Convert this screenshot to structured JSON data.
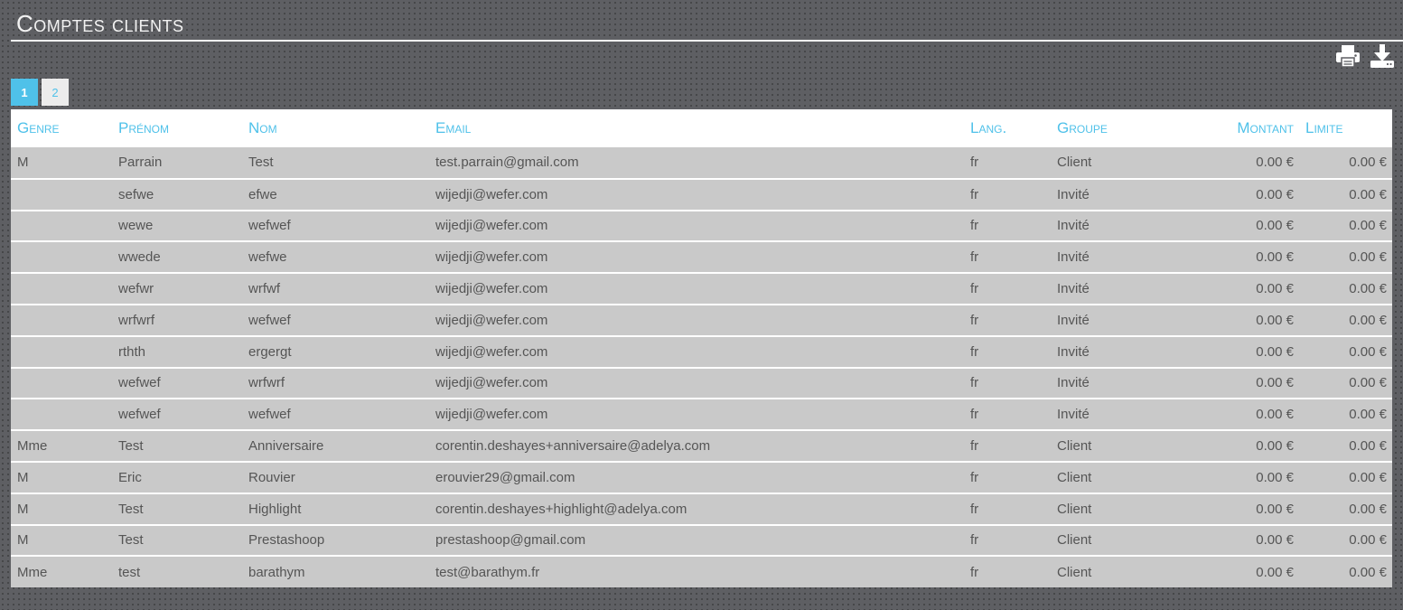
{
  "page": {
    "title": "Comptes clients"
  },
  "toolbar": {
    "print_icon": "print-icon",
    "download_icon": "download-icon"
  },
  "pagination": {
    "pages": [
      "1",
      "2"
    ],
    "current": "1"
  },
  "table": {
    "headers": {
      "genre": "Genre",
      "prenom": "Prénom",
      "nom": "Nom",
      "email": "Email",
      "lang": "Lang.",
      "groupe": "Groupe",
      "montant": "Montant",
      "limite": "Limite"
    },
    "rows": [
      {
        "genre": "M",
        "prenom": "Parrain",
        "nom": "Test",
        "email": "test.parrain@gmail.com",
        "lang": "fr",
        "groupe": "Client",
        "montant": "0.00 €",
        "limite": "0.00 €"
      },
      {
        "genre": "",
        "prenom": "sefwe",
        "nom": "efwe",
        "email": "wijedji@wefer.com",
        "lang": "fr",
        "groupe": "Invité",
        "montant": "0.00 €",
        "limite": "0.00 €"
      },
      {
        "genre": "",
        "prenom": "wewe",
        "nom": "wefwef",
        "email": "wijedji@wefer.com",
        "lang": "fr",
        "groupe": "Invité",
        "montant": "0.00 €",
        "limite": "0.00 €"
      },
      {
        "genre": "",
        "prenom": "wwede",
        "nom": "wefwe",
        "email": "wijedji@wefer.com",
        "lang": "fr",
        "groupe": "Invité",
        "montant": "0.00 €",
        "limite": "0.00 €"
      },
      {
        "genre": "",
        "prenom": "wefwr",
        "nom": "wrfwf",
        "email": "wijedji@wefer.com",
        "lang": "fr",
        "groupe": "Invité",
        "montant": "0.00 €",
        "limite": "0.00 €"
      },
      {
        "genre": "",
        "prenom": "wrfwrf",
        "nom": "wefwef",
        "email": "wijedji@wefer.com",
        "lang": "fr",
        "groupe": "Invité",
        "montant": "0.00 €",
        "limite": "0.00 €"
      },
      {
        "genre": "",
        "prenom": "rthth",
        "nom": "ergergt",
        "email": "wijedji@wefer.com",
        "lang": "fr",
        "groupe": "Invité",
        "montant": "0.00 €",
        "limite": "0.00 €"
      },
      {
        "genre": "",
        "prenom": "wefwef",
        "nom": "wrfwrf",
        "email": "wijedji@wefer.com",
        "lang": "fr",
        "groupe": "Invité",
        "montant": "0.00 €",
        "limite": "0.00 €"
      },
      {
        "genre": "",
        "prenom": "wefwef",
        "nom": "wefwef",
        "email": "wijedji@wefer.com",
        "lang": "fr",
        "groupe": "Invité",
        "montant": "0.00 €",
        "limite": "0.00 €"
      },
      {
        "genre": "Mme",
        "prenom": "Test",
        "nom": "Anniversaire",
        "email": "corentin.deshayes+anniversaire@adelya.com",
        "lang": "fr",
        "groupe": "Client",
        "montant": "0.00 €",
        "limite": "0.00 €"
      },
      {
        "genre": "M",
        "prenom": "Eric",
        "nom": "Rouvier",
        "email": "erouvier29@gmail.com",
        "lang": "fr",
        "groupe": "Client",
        "montant": "0.00 €",
        "limite": "0.00 €"
      },
      {
        "genre": "M",
        "prenom": "Test",
        "nom": "Highlight",
        "email": "corentin.deshayes+highlight@adelya.com",
        "lang": "fr",
        "groupe": "Client",
        "montant": "0.00 €",
        "limite": "0.00 €"
      },
      {
        "genre": "M",
        "prenom": "Test",
        "nom": "Prestashoop",
        "email": "prestashoop@gmail.com",
        "lang": "fr",
        "groupe": "Client",
        "montant": "0.00 €",
        "limite": "0.00 €"
      },
      {
        "genre": "Mme",
        "prenom": "test",
        "nom": "barathym",
        "email": "test@barathym.fr",
        "lang": "fr",
        "groupe": "Client",
        "montant": "0.00 €",
        "limite": "0.00 €"
      }
    ]
  },
  "colors": {
    "accent": "#4fc1e9",
    "background": "#5e5f63",
    "row_background": "#c9c9c9",
    "text": "#555555"
  }
}
